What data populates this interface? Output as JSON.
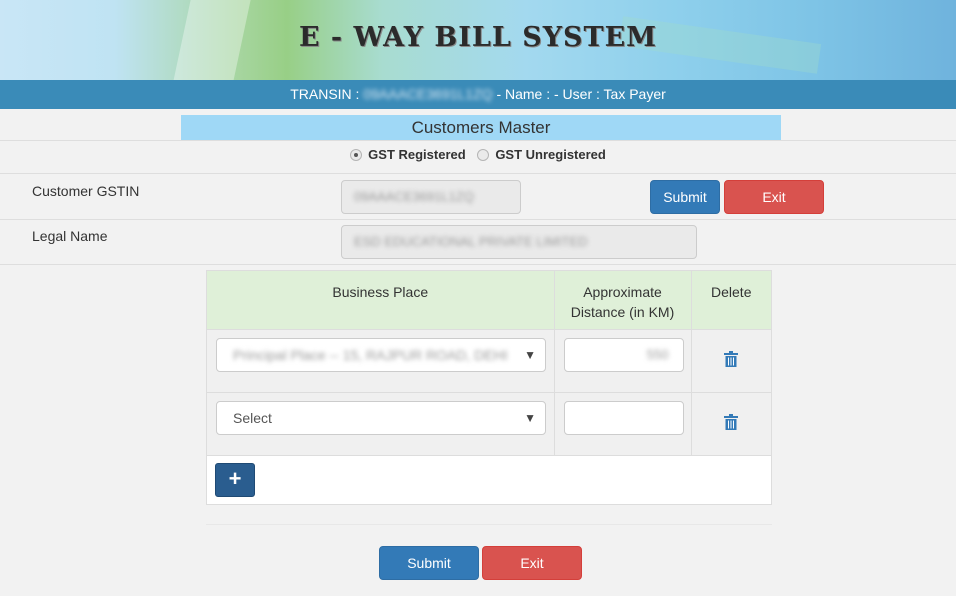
{
  "header": {
    "title": "E - WAY BILL SYSTEM",
    "userbar": {
      "prefix": "TRANSIN :",
      "transin_value": "09AAACE3691L1ZQ",
      "suffix": "- Name : - User : Tax Payer"
    }
  },
  "page": {
    "title": "Customers Master"
  },
  "registration_type": {
    "options": [
      {
        "label": "GST Registered",
        "selected": true
      },
      {
        "label": "GST Unregistered",
        "selected": false
      }
    ]
  },
  "form": {
    "gstin_label": "Customer GSTIN",
    "gstin_value": "09AAACE3691L1ZQ",
    "legal_name_label": "Legal Name",
    "legal_name_value": "ESD EDUCATIONAL PRIVATE LIMITED",
    "submit_label": "Submit",
    "exit_label": "Exit"
  },
  "grid": {
    "columns": [
      "Business Place",
      "Approximate Distance (in KM)",
      "Delete"
    ],
    "column_header_lines": {
      "distance_line1": "Approximate",
      "distance_line2": "Distance (in KM)"
    },
    "rows": [
      {
        "business_place": "Principal Place -- 15, RAJPUR ROAD, DEHI",
        "distance": "550",
        "blurred": true
      },
      {
        "business_place": "Select",
        "distance": "",
        "blurred": false
      }
    ],
    "add_label": "+"
  },
  "footer": {
    "submit_label": "Submit",
    "exit_label": "Exit"
  },
  "colors": {
    "userbar": "#3a8bb8",
    "title_bar": "#9fd8f6",
    "grid_header": "#dff0d8",
    "primary": "#337ab7",
    "danger": "#d9534f",
    "add_button": "#2a5d8f"
  }
}
